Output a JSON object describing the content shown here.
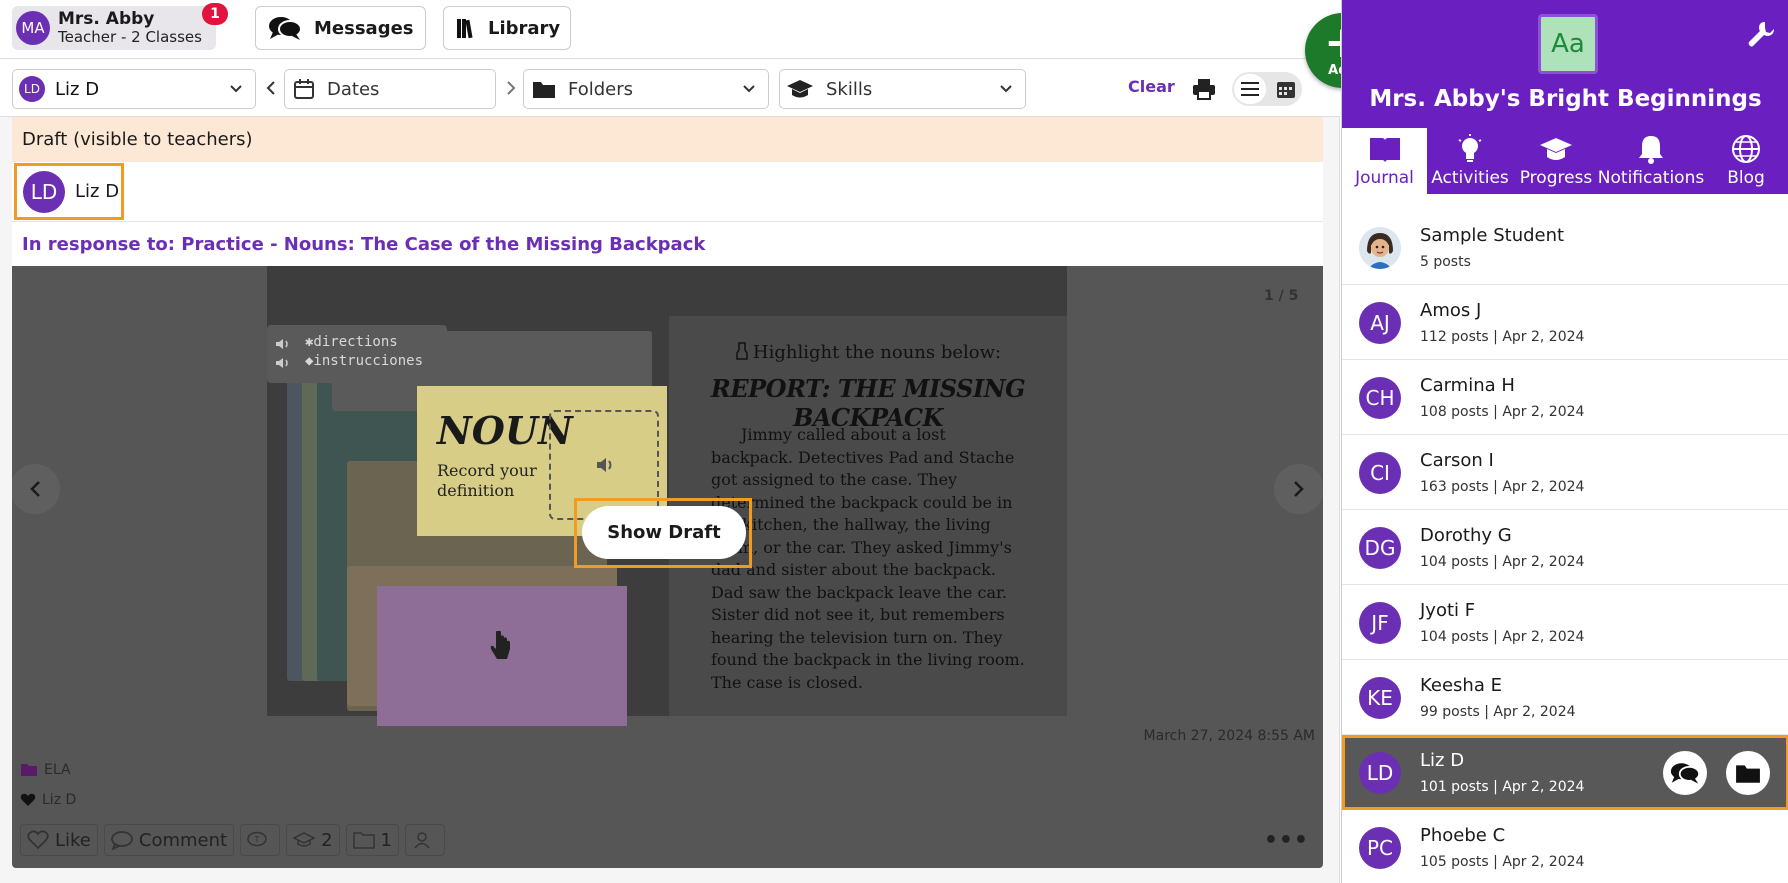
{
  "header": {
    "teacher_initials": "MA",
    "teacher_name": "Mrs. Abby",
    "teacher_subtitle": "Teacher - 2 Classes",
    "notification_count": "1",
    "messages_label": "Messages",
    "library_label": "Library"
  },
  "filters": {
    "student_initials": "LD",
    "student_value": "Liz D",
    "dates_label": "Dates",
    "folders_label": "Folders",
    "skills_label": "Skills",
    "clear_label": "Clear"
  },
  "post": {
    "draft_notice": "Draft (visible to teachers)",
    "author_initials": "LD",
    "author_name": "Liz D",
    "in_response_to": "In response to: Practice - Nouns: The Case of the Missing Backpack",
    "page_indicator": "1 / 5",
    "show_draft_label": "Show Draft",
    "timestamp": "March 27, 2024 8:55 AM",
    "folder_tag": "ELA",
    "liked_by": "Liz D",
    "actions": {
      "like": "Like",
      "comment": "Comment",
      "skills_count": "2",
      "folders_count": "1"
    },
    "slide": {
      "directions_line1": "✱directions",
      "directions_line2": "◆instrucciones",
      "noun_title": "NOUN",
      "noun_subtitle": "Record your definition",
      "highlight_prompt": "Highlight the nouns below:",
      "report_title": "REPORT: THE MISSING BACKPACK",
      "report_text": "Jimmy called about a lost backpack. Detectives Pad and Stache got assigned to the case. They determined the backpack could be in the kitchen, the hallway, the living room, or the car. They asked Jimmy's dad and sister about the backpack. Dad saw the backpack leave the car. Sister did not see it, but remembers hearing the television turn on. They found the backpack in the living room. The case is closed."
    }
  },
  "add_button": {
    "label": "Add"
  },
  "sidebar": {
    "class_logo_text": "Aa",
    "class_name": "Mrs. Abby's Bright Beginnings",
    "tabs": [
      {
        "label": "Journal"
      },
      {
        "label": "Activities"
      },
      {
        "label": "Progress"
      },
      {
        "label": "Notifications"
      },
      {
        "label": "Blog"
      }
    ],
    "students": [
      {
        "initials": "",
        "name": "Sample Student",
        "meta": "5 posts"
      },
      {
        "initials": "AJ",
        "name": "Amos J",
        "meta": "112 posts | Apr 2, 2024"
      },
      {
        "initials": "CH",
        "name": "Carmina H",
        "meta": "108 posts | Apr 2, 2024"
      },
      {
        "initials": "CI",
        "name": "Carson I",
        "meta": "163 posts | Apr 2, 2024"
      },
      {
        "initials": "DG",
        "name": "Dorothy G",
        "meta": "104 posts | Apr 2, 2024"
      },
      {
        "initials": "JF",
        "name": "Jyoti F",
        "meta": "104 posts | Apr 2, 2024"
      },
      {
        "initials": "KE",
        "name": "Keesha E",
        "meta": "99 posts | Apr 2, 2024"
      },
      {
        "initials": "LD",
        "name": "Liz D",
        "meta": "101 posts | Apr 2, 2024"
      },
      {
        "initials": "PC",
        "name": "Phoebe C",
        "meta": "105 posts | Apr 2, 2024"
      }
    ]
  },
  "colors": {
    "brand_purple": "#6a1fc1",
    "highlight_orange": "#f39a22",
    "add_green": "#1d7a2a",
    "badge_red": "#e0143c"
  }
}
